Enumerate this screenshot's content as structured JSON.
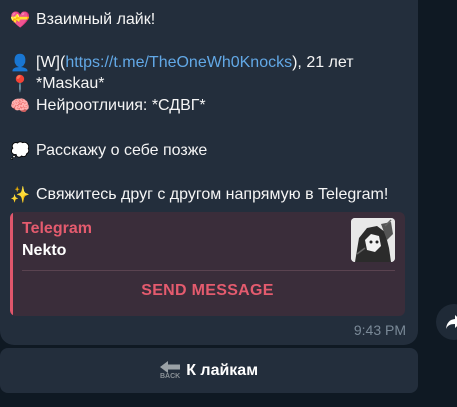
{
  "message": {
    "line1": {
      "icon": "heart-gift-icon",
      "glyph": "💝",
      "text": "Взаимный лайк!"
    },
    "line2": {
      "icon": "user-silhouette-icon",
      "glyph": "👤",
      "prefix": "[W](",
      "link": "https://t.me/TheOneWh0Knocks",
      "suffix": "), 21 лет"
    },
    "line3": {
      "icon": "location-pin-icon",
      "glyph": "📍",
      "text": "*Maskau*"
    },
    "line4": {
      "icon": "brain-icon",
      "glyph": "🧠",
      "text": "Нейроотличия: *СДВГ*"
    },
    "line5": {
      "icon": "thought-bubble-icon",
      "glyph": "💭",
      "text": "Расскажу о себе позже"
    },
    "line6": {
      "icon": "sparkles-icon",
      "glyph": "✨",
      "text": "Свяжитесь друг с другом напрямую в Telegram!"
    },
    "time": "9:43 PM"
  },
  "preview": {
    "site": "Telegram",
    "title": "Nekto",
    "action": "SEND MESSAGE",
    "thumb_icon": "anime-avatar-icon"
  },
  "keyboard": {
    "button_label": "К лайкам",
    "icon": "back-arrow-icon",
    "icon_text": "BACK"
  },
  "colors": {
    "background": "#0f1923",
    "bubble": "#232e3c",
    "link": "#62a8e6",
    "accent": "#e45b6e",
    "preview_bg": "#3a2d3a"
  }
}
